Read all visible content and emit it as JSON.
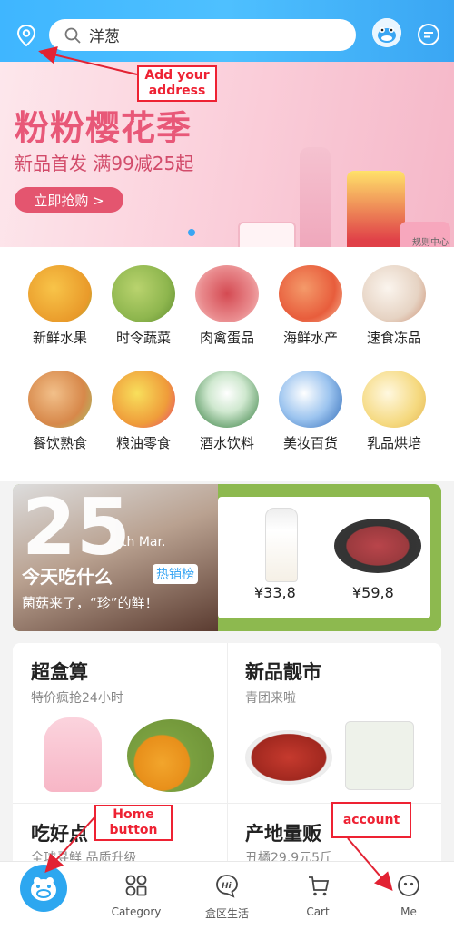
{
  "header": {
    "search_value": "洋葱",
    "icons": {
      "location": "map-pin-icon",
      "search": "search-icon",
      "avatar": "mascot-avatar",
      "message": "chat-icon"
    }
  },
  "banner": {
    "title": "粉粉樱花季",
    "subtitle": "新品首发 满99减25起",
    "cta": "立即抢购 >",
    "ad_note": "规则中心"
  },
  "categories": [
    {
      "label": "新鲜水果",
      "color": "#f3b23a"
    },
    {
      "label": "时令蔬菜",
      "color": "#9ac25a"
    },
    {
      "label": "肉禽蛋品",
      "color": "#e8777a"
    },
    {
      "label": "海鲜水产",
      "color": "#f07a4a"
    },
    {
      "label": "速食冻品",
      "color": "#d9c1b0"
    },
    {
      "label": "餐饮熟食",
      "color": "#e2a266"
    },
    {
      "label": "粮油零食",
      "color": "#f2c53d"
    },
    {
      "label": "酒水饮料",
      "color": "#64a86a"
    },
    {
      "label": "美妆百货",
      "color": "#6f9fd8"
    },
    {
      "label": "乳品烘培",
      "color": "#f3d583"
    }
  ],
  "promo": {
    "day": "25",
    "date_suffix": "th Mar.",
    "title": "今天吃什么",
    "tag": "热销榜",
    "desc": "菌菇来了，“珍”的鲜！",
    "prices": [
      "¥33,8",
      "¥59,8"
    ]
  },
  "cards": [
    {
      "title": "超盒算",
      "sub": "特价疯抢24小时"
    },
    {
      "title": "新品靓市",
      "sub": "青团来啦"
    },
    {
      "title": "吃好点",
      "sub": "全球寻鲜 品质升级"
    },
    {
      "title": "产地量贩",
      "sub": "丑橘29.9元5斤"
    }
  ],
  "nav": {
    "home": "",
    "category": "Category",
    "community": "盒区生活",
    "cart": "Cart",
    "me": "Me"
  },
  "annotations": {
    "address": "Add your address",
    "home": "Home button",
    "account": "account"
  },
  "colors": {
    "brand_blue": "#3aa6f3",
    "annotation_red": "#e22233"
  }
}
